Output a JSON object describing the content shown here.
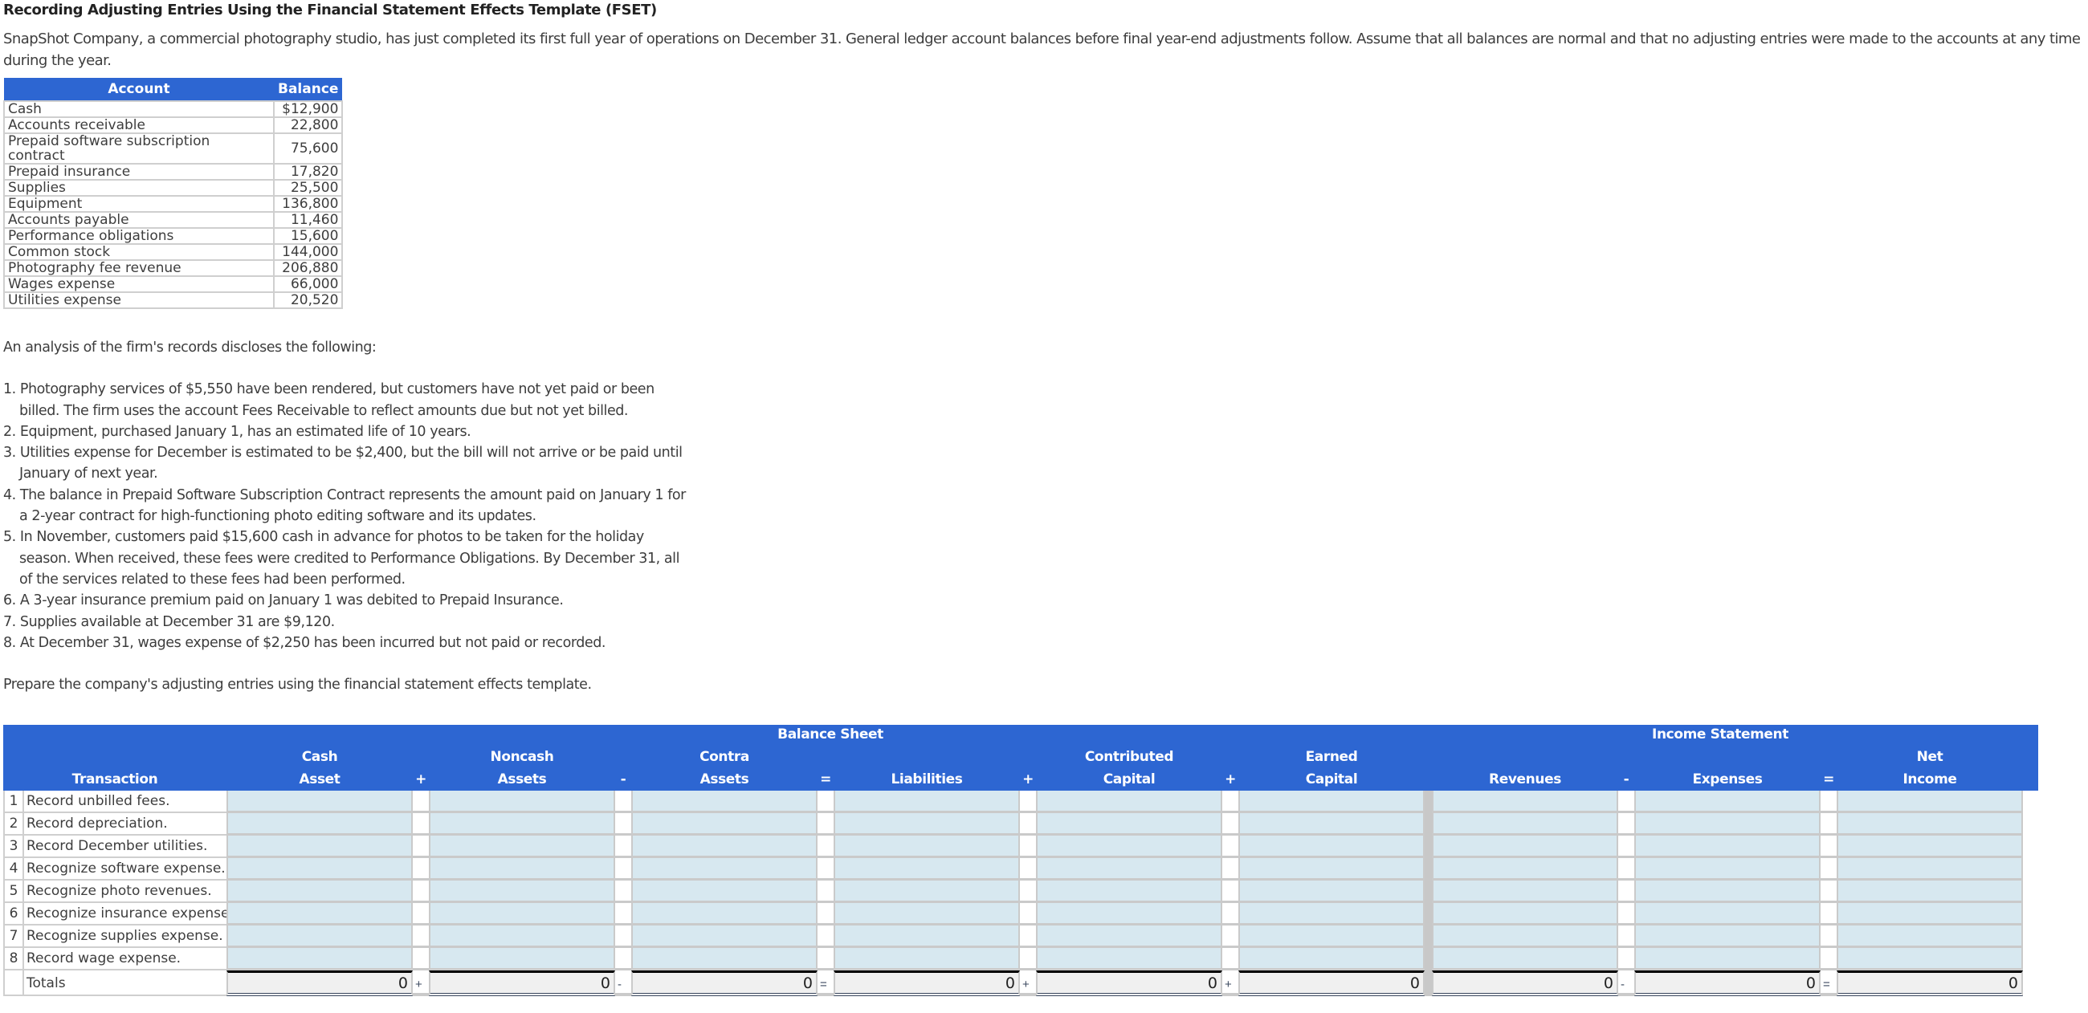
{
  "title": "Recording Adjusting Entries Using the Financial Statement Effects Template (FSET)",
  "intro": "SnapShot Company, a commercial photography studio, has just completed its first full year of operations on December 31. General ledger account balances before final year-end adjustments follow. Assume that all balances are normal and that no adjusting entries were made to the accounts at any time during the year.",
  "accounts": {
    "headers": {
      "account": "Account",
      "balance": "Balance"
    },
    "rows": [
      {
        "account": "Cash",
        "balance": "$12,900"
      },
      {
        "account": "Accounts receivable",
        "balance": "22,800"
      },
      {
        "account": "Prepaid software subscription contract",
        "balance": "75,600"
      },
      {
        "account": "Prepaid insurance",
        "balance": "17,820"
      },
      {
        "account": "Supplies",
        "balance": "25,500"
      },
      {
        "account": "Equipment",
        "balance": "136,800"
      },
      {
        "account": "Accounts payable",
        "balance": "11,460"
      },
      {
        "account": "Performance obligations",
        "balance": "15,600"
      },
      {
        "account": "Common stock",
        "balance": "144,000"
      },
      {
        "account": "Photography fee revenue",
        "balance": "206,880"
      },
      {
        "account": "Wages expense",
        "balance": "66,000"
      },
      {
        "account": "Utilities expense",
        "balance": "20,520"
      }
    ]
  },
  "analysis": {
    "lead": "An analysis of the firm's records discloses the following:",
    "items": [
      "1. Photography services of $5,550 have been rendered, but customers have not yet paid or been billed. The firm uses the account Fees Receivable to reflect amounts due but not yet billed.",
      "2. Equipment, purchased January 1, has an estimated life of 10 years.",
      "3. Utilities expense for December is estimated to be $2,400, but the bill will not arrive or be paid until January of next year.",
      "4. The balance in Prepaid Software Subscription Contract represents the amount paid on January 1 for a 2-year contract for high-functioning photo editing software and its updates.",
      "5. In November, customers paid $15,600 cash in advance for photos to be taken for the holiday season. When received, these fees were credited to Performance Obligations. By December 31, all of the services related to these fees had been performed.",
      "6. A 3-year insurance premium paid on January 1 was debited to Prepaid Insurance.",
      "7. Supplies available at December 31 are $9,120.",
      "8. At December 31, wages expense of $2,250 has been incurred but not paid or recorded."
    ],
    "instruction": "Prepare the company's adjusting entries using the financial statement effects template."
  },
  "fset": {
    "group_headers": {
      "balance_sheet": "Balance Sheet",
      "income_statement": "Income Statement"
    },
    "columns": {
      "transaction": "Transaction",
      "cash_1": "Cash",
      "cash_2": "Asset",
      "noncash_1": "Noncash",
      "noncash_2": "Assets",
      "contra_1": "Contra",
      "contra_2": "Assets",
      "liabilities": "Liabilities",
      "contributed_1": "Contributed",
      "contributed_2": "Capital",
      "earned_1": "Earned",
      "earned_2": "Capital",
      "revenues": "Revenues",
      "expenses": "Expenses",
      "net_1": "Net",
      "net_2": "Income"
    },
    "operators": {
      "op1": "+",
      "op2": "-",
      "op3": "=",
      "op4": "+",
      "op5": "+",
      "op6": "-",
      "op7": "="
    },
    "transactions": [
      {
        "num": "1",
        "label": "Record unbilled fees."
      },
      {
        "num": "2",
        "label": "Record depreciation."
      },
      {
        "num": "3",
        "label": "Record December utilities."
      },
      {
        "num": "4",
        "label": "Recognize software expense."
      },
      {
        "num": "5",
        "label": "Recognize photo revenues."
      },
      {
        "num": "6",
        "label": "Recognize insurance expense"
      },
      {
        "num": "7",
        "label": "Recognize supplies expense."
      },
      {
        "num": "8",
        "label": "Record wage expense."
      }
    ],
    "totals": {
      "label": "Totals",
      "cash": "0",
      "noncash": "0",
      "contra": "0",
      "liabilities": "0",
      "contributed": "0",
      "earned": "0",
      "revenues": "0",
      "expenses": "0",
      "net_income": "0"
    },
    "colors": {
      "header_bg": "#2d66d2",
      "input_bg": "#d7e8f0",
      "totals_bg": "#f0f0f0"
    }
  }
}
